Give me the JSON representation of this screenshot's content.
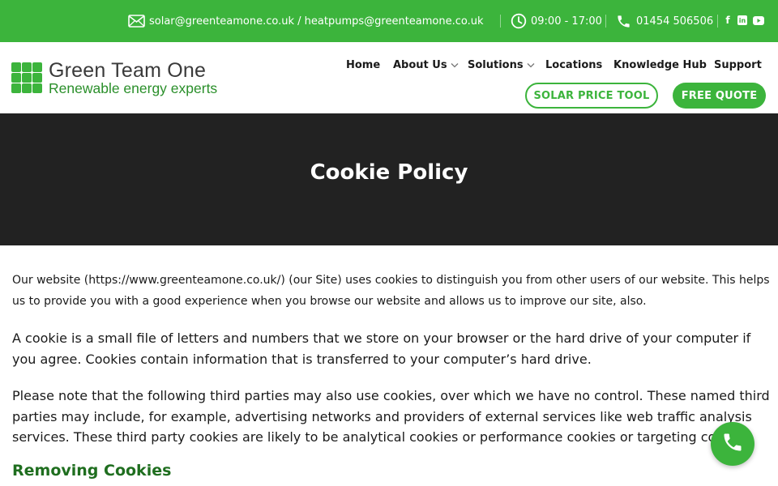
{
  "topbar": {
    "email_text": "solar@greenteamone.co.uk / heatpumps@greenteamone.co.uk",
    "hours": "09:00 - 17:00",
    "phone": "01454 506506",
    "social": [
      "facebook-icon",
      "linkedin-icon",
      "youtube-icon"
    ],
    "facebook_glyph": "f",
    "linkedin_glyph": "in"
  },
  "brand": {
    "name": "Green Team One",
    "tagline": "Renewable energy experts"
  },
  "nav": {
    "items": [
      {
        "label": "Home"
      },
      {
        "label": "About Us"
      },
      {
        "label": "Solutions"
      },
      {
        "label": "Locations"
      },
      {
        "label": "Knowledge Hub"
      },
      {
        "label": "Support"
      }
    ],
    "solar_tool": "SOLAR PRICE TOOL",
    "free_quote": "FREE QUOTE"
  },
  "hero": {
    "title": "Cookie Policy"
  },
  "content": {
    "p1": "Our website (https://www.greenteamone.co.uk/) (our Site) uses cookies to distinguish you from other users of our website. This helps us to provide you with a good experience when you browse our website and allows us to improve our site, also.",
    "p2": "A cookie is a small file of letters and numbers that we store on your browser or the hard drive of your computer if you agree. Cookies contain information that is transferred to your computer’s hard drive.",
    "p3": "Please note that the following third parties may also use cookies, over which we have no control. These named third parties may include, for example, advertising networks and providers of external services like web traffic analysis services. These third party cookies are likely to be analytical cookies or performance cookies or targeting cookies.",
    "h2": "Removing Cookies"
  },
  "colors": {
    "brand_green": "#3cb43c",
    "dark_green": "#1f6e1f",
    "hero_bg": "#222222"
  }
}
